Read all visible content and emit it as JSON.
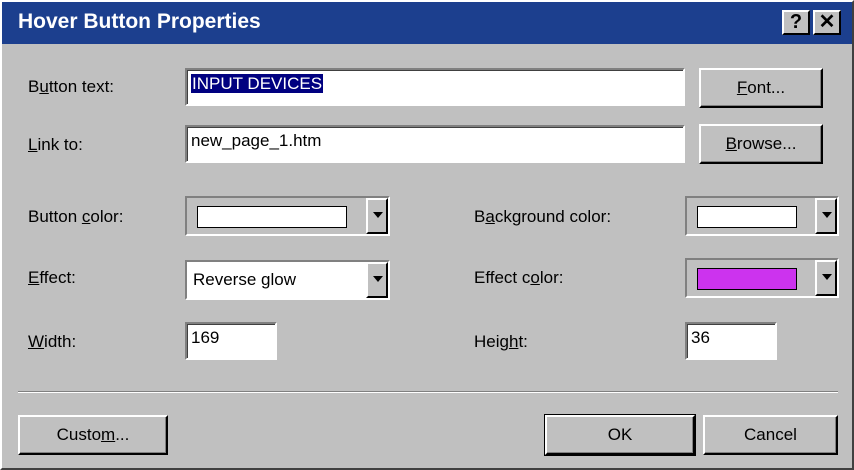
{
  "window": {
    "title": "Hover Button Properties",
    "help_label": "?",
    "close_label": "✕"
  },
  "form": {
    "button_text": {
      "label_pre": "B",
      "label_key": "u",
      "label_post": "tton text:",
      "value": "INPUT DEVICES"
    },
    "link_to": {
      "label_pre": "",
      "label_key": "L",
      "label_post": "ink to:",
      "value": "new_page_1.htm"
    },
    "button_color": {
      "label_pre": "Button ",
      "label_key": "c",
      "label_post": "olor:",
      "color": "#ffffff"
    },
    "background_color": {
      "label_pre": "B",
      "label_key": "a",
      "label_post": "ckground color:",
      "color": "#ffffff"
    },
    "effect": {
      "label_pre": "",
      "label_key": "E",
      "label_post": "ffect:",
      "value": "Reverse glow"
    },
    "effect_color": {
      "label_pre": "Effect c",
      "label_key": "o",
      "label_post": "lor:",
      "color": "#cc33ee"
    },
    "width": {
      "label_pre": "",
      "label_key": "W",
      "label_post": "idth:",
      "value": "169"
    },
    "height": {
      "label_pre": "Heig",
      "label_key": "h",
      "label_post": "t:",
      "value": "36"
    }
  },
  "buttons": {
    "font": {
      "pre": "",
      "key": "F",
      "post": "ont..."
    },
    "browse": {
      "pre": "",
      "key": "B",
      "post": "rowse..."
    },
    "custom": {
      "pre": "Custo",
      "key": "m",
      "post": "..."
    },
    "ok": "OK",
    "cancel": "Cancel"
  },
  "colors": {
    "titlebar": "#1c3f8e",
    "dialog": "#c0c0c0",
    "selection": "#000080"
  }
}
